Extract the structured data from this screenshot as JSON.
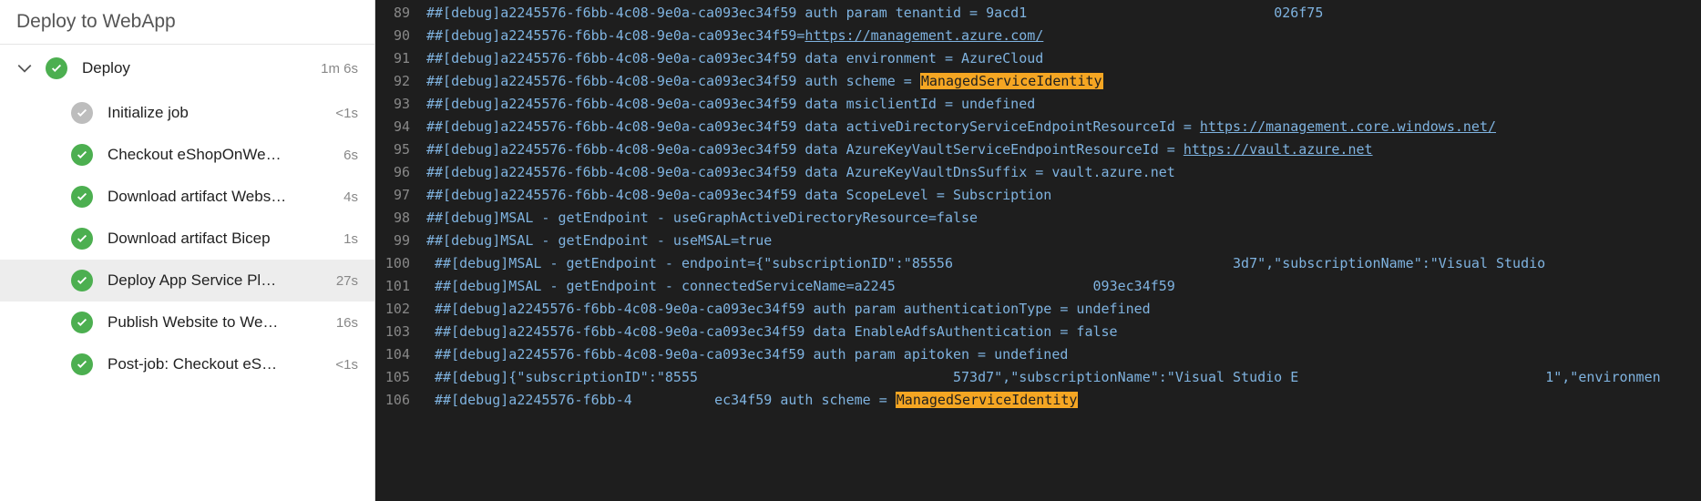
{
  "sidebar": {
    "title": "Deploy to WebApp",
    "job": {
      "name": "Deploy",
      "duration": "1m 6s"
    },
    "steps": [
      {
        "name": "Initialize job",
        "duration": "<1s",
        "status": "skipped",
        "active": false
      },
      {
        "name": "Checkout eShopOnWe…",
        "duration": "6s",
        "status": "success",
        "active": false
      },
      {
        "name": "Download artifact Webs…",
        "duration": "4s",
        "status": "success",
        "active": false
      },
      {
        "name": "Download artifact Bicep",
        "duration": "1s",
        "status": "success",
        "active": false
      },
      {
        "name": "Deploy App Service Pl…",
        "duration": "27s",
        "status": "success",
        "active": true
      },
      {
        "name": "Publish Website to We…",
        "duration": "16s",
        "status": "success",
        "active": false
      },
      {
        "name": "Post-job: Checkout eS…",
        "duration": "<1s",
        "status": "success",
        "active": false
      }
    ]
  },
  "log": {
    "highlight": "ManagedServiceIdentity",
    "lines": [
      {
        "n": 89,
        "segs": [
          {
            "t": "##[debug]a2245576-f6bb-4c08-9e0a-ca093ec34f59 auth param tenantid = 9acd1"
          },
          {
            "t": "                              ",
            "gap": true
          },
          {
            "t": "026f75"
          }
        ]
      },
      {
        "n": 90,
        "segs": [
          {
            "t": "##[debug]a2245576-f6bb-4c08-9e0a-ca093ec34f59="
          },
          {
            "t": "https://management.azure.com/",
            "link": true
          }
        ]
      },
      {
        "n": 91,
        "segs": [
          {
            "t": "##[debug]a2245576-f6bb-4c08-9e0a-ca093ec34f59 data environment = AzureCloud"
          }
        ]
      },
      {
        "n": 92,
        "segs": [
          {
            "t": "##[debug]a2245576-f6bb-4c08-9e0a-ca093ec34f59 auth scheme = "
          },
          {
            "t": "ManagedServiceIdentity",
            "hl": true
          }
        ]
      },
      {
        "n": 93,
        "segs": [
          {
            "t": "##[debug]a2245576-f6bb-4c08-9e0a-ca093ec34f59 data msiclientId = undefined"
          }
        ]
      },
      {
        "n": 94,
        "segs": [
          {
            "t": "##[debug]a2245576-f6bb-4c08-9e0a-ca093ec34f59 data activeDirectoryServiceEndpointResourceId = "
          },
          {
            "t": "https://management.core.windows.net/",
            "link": true
          }
        ]
      },
      {
        "n": 95,
        "segs": [
          {
            "t": "##[debug]a2245576-f6bb-4c08-9e0a-ca093ec34f59 data AzureKeyVaultServiceEndpointResourceId = "
          },
          {
            "t": "https://vault.azure.net",
            "link": true
          }
        ]
      },
      {
        "n": 96,
        "segs": [
          {
            "t": "##[debug]a2245576-f6bb-4c08-9e0a-ca093ec34f59 data AzureKeyVaultDnsSuffix = vault.azure.net"
          }
        ]
      },
      {
        "n": 97,
        "segs": [
          {
            "t": "##[debug]a2245576-f6bb-4c08-9e0a-ca093ec34f59 data ScopeLevel = Subscription"
          }
        ]
      },
      {
        "n": 98,
        "segs": [
          {
            "t": "##[debug]MSAL - getEndpoint - useGraphActiveDirectoryResource=false"
          }
        ]
      },
      {
        "n": 99,
        "segs": [
          {
            "t": "##[debug]MSAL - getEndpoint - useMSAL=true"
          }
        ]
      },
      {
        "n": 100,
        "segs": [
          {
            "t": " ##[debug]MSAL - getEndpoint - endpoint={\"subscriptionID\":\"85556"
          },
          {
            "t": "                                  ",
            "gap": true
          },
          {
            "t": "3d7\",\"subscriptionName\":\"Visual Studio "
          }
        ]
      },
      {
        "n": 101,
        "segs": [
          {
            "t": " ##[debug]MSAL - getEndpoint - connectedServiceName=a2245"
          },
          {
            "t": "                        ",
            "gap": true
          },
          {
            "t": "093ec34f59"
          }
        ]
      },
      {
        "n": 102,
        "segs": [
          {
            "t": " ##[debug]a2245576-f6bb-4c08-9e0a-ca093ec34f59 auth param authenticationType = undefined"
          }
        ]
      },
      {
        "n": 103,
        "segs": [
          {
            "t": " ##[debug]a2245576-f6bb-4c08-9e0a-ca093ec34f59 data EnableAdfsAuthentication = false"
          }
        ]
      },
      {
        "n": 104,
        "segs": [
          {
            "t": " ##[debug]a2245576-f6bb-4c08-9e0a-ca093ec34f59 auth param apitoken = undefined"
          }
        ]
      },
      {
        "n": 105,
        "segs": [
          {
            "t": " ##[debug]{\"subscriptionID\":\"8555"
          },
          {
            "t": "                               ",
            "gap": true
          },
          {
            "t": "573d7\",\"subscriptionName\":\"Visual Studio E"
          },
          {
            "t": "                              ",
            "gap": true
          },
          {
            "t": "1\",\"environmen"
          }
        ]
      },
      {
        "n": 106,
        "segs": [
          {
            "t": " ##[debug]a2245576-f6bb-4"
          },
          {
            "t": "          ",
            "gap": true
          },
          {
            "t": "ec34f59 auth scheme = "
          },
          {
            "t": "ManagedServiceIdentity",
            "hl": true
          }
        ]
      }
    ]
  }
}
